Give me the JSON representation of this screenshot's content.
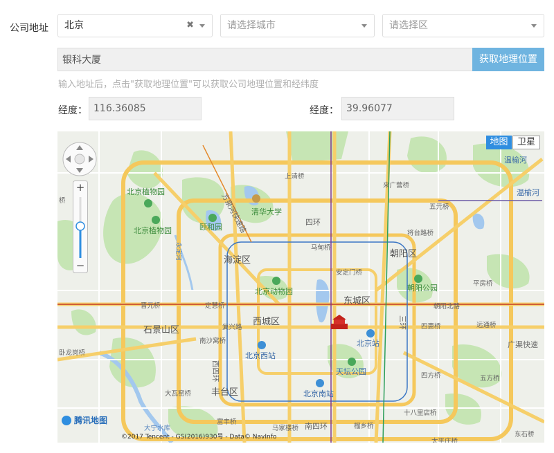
{
  "form": {
    "address_label": "公司地址",
    "province": {
      "value": "北京",
      "clear_glyph": "✖"
    },
    "city": {
      "placeholder": "请选择城市"
    },
    "district": {
      "placeholder": "请选择区"
    },
    "address_value": "银科大厦",
    "geo_button_label": "获取地理位置",
    "hint": "输入地址后，点击\"获取地理位置\"可以获取公司地理位置和经纬度",
    "longitude_label": "经度：",
    "longitude_value": "116.36085",
    "latitude_label": "经度：",
    "latitude_value": "39.96077"
  },
  "map": {
    "type_map_label": "地图",
    "type_satellite_label": "卫星",
    "zoom_in": "+",
    "zoom_out": "−",
    "logo_text": "腾讯地图",
    "copyright": "©2017 Tencent - GS(2016)930号 - Data© NavInfo",
    "colors": {
      "water": "#a3c8ee",
      "park": "#c6e5b4",
      "road_major": "#f6cf6a",
      "road_ring": "#f5c85c",
      "bg": "#eef0ea",
      "accent": "#2f8ee0"
    },
    "district_labels": [
      {
        "text": "海淀区"
      },
      {
        "text": "西城区"
      },
      {
        "text": "东城区"
      },
      {
        "text": "朝阳区"
      },
      {
        "text": "石景山区"
      },
      {
        "text": "丰台区"
      }
    ],
    "poi_labels": [
      {
        "text": "北京植物园"
      },
      {
        "text": "北京植物园"
      },
      {
        "text": "颐和园"
      },
      {
        "text": "清华大学"
      },
      {
        "text": "北京动物园"
      },
      {
        "text": "朝阳公园"
      },
      {
        "text": "天坛公园"
      },
      {
        "text": "北京站"
      },
      {
        "text": "北京西站"
      },
      {
        "text": "北京南站"
      },
      {
        "text": "温榆河"
      },
      {
        "text": "温榆河"
      }
    ],
    "road_labels": [
      {
        "text": "上清桥"
      },
      {
        "text": "来广营桥"
      },
      {
        "text": "五元桥"
      },
      {
        "text": "四环"
      },
      {
        "text": "马甸桥"
      },
      {
        "text": "将台路桥"
      },
      {
        "text": "安定门桥"
      },
      {
        "text": "平房桥"
      },
      {
        "text": "晋元桥"
      },
      {
        "text": "定慧桥"
      },
      {
        "text": "朝阳北路"
      },
      {
        "text": "复兴路"
      },
      {
        "text": "四惠桥"
      },
      {
        "text": "远通桥"
      },
      {
        "text": "南沙窝桥"
      },
      {
        "text": "广渠快速"
      },
      {
        "text": "卧龙岗桥"
      },
      {
        "text": "四方桥"
      },
      {
        "text": "五方桥"
      },
      {
        "text": "大瓦窑桥"
      },
      {
        "text": "十八里店桥"
      },
      {
        "text": "富丰桥"
      },
      {
        "text": "马家楼桥"
      },
      {
        "text": "南四环"
      },
      {
        "text": "榴乡桥"
      },
      {
        "text": "东石桥"
      },
      {
        "text": "方泉河快速路"
      },
      {
        "text": "西四环"
      },
      {
        "text": "三环"
      },
      {
        "text": "永定河"
      },
      {
        "text": "桥"
      },
      {
        "text": "太平庄桥"
      },
      {
        "text": "大宁水库"
      }
    ]
  }
}
